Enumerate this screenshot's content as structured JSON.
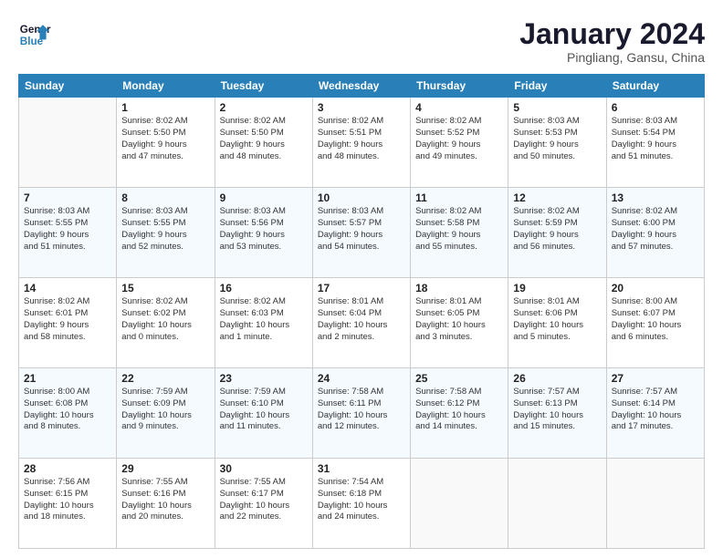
{
  "logo": {
    "line1": "General",
    "line2": "Blue"
  },
  "title": "January 2024",
  "subtitle": "Pingliang, Gansu, China",
  "days_header": [
    "Sunday",
    "Monday",
    "Tuesday",
    "Wednesday",
    "Thursday",
    "Friday",
    "Saturday"
  ],
  "weeks": [
    [
      {
        "day": "",
        "info": ""
      },
      {
        "day": "1",
        "info": "Sunrise: 8:02 AM\nSunset: 5:50 PM\nDaylight: 9 hours\nand 47 minutes."
      },
      {
        "day": "2",
        "info": "Sunrise: 8:02 AM\nSunset: 5:50 PM\nDaylight: 9 hours\nand 48 minutes."
      },
      {
        "day": "3",
        "info": "Sunrise: 8:02 AM\nSunset: 5:51 PM\nDaylight: 9 hours\nand 48 minutes."
      },
      {
        "day": "4",
        "info": "Sunrise: 8:02 AM\nSunset: 5:52 PM\nDaylight: 9 hours\nand 49 minutes."
      },
      {
        "day": "5",
        "info": "Sunrise: 8:03 AM\nSunset: 5:53 PM\nDaylight: 9 hours\nand 50 minutes."
      },
      {
        "day": "6",
        "info": "Sunrise: 8:03 AM\nSunset: 5:54 PM\nDaylight: 9 hours\nand 51 minutes."
      }
    ],
    [
      {
        "day": "7",
        "info": "Sunrise: 8:03 AM\nSunset: 5:55 PM\nDaylight: 9 hours\nand 51 minutes."
      },
      {
        "day": "8",
        "info": "Sunrise: 8:03 AM\nSunset: 5:55 PM\nDaylight: 9 hours\nand 52 minutes."
      },
      {
        "day": "9",
        "info": "Sunrise: 8:03 AM\nSunset: 5:56 PM\nDaylight: 9 hours\nand 53 minutes."
      },
      {
        "day": "10",
        "info": "Sunrise: 8:03 AM\nSunset: 5:57 PM\nDaylight: 9 hours\nand 54 minutes."
      },
      {
        "day": "11",
        "info": "Sunrise: 8:02 AM\nSunset: 5:58 PM\nDaylight: 9 hours\nand 55 minutes."
      },
      {
        "day": "12",
        "info": "Sunrise: 8:02 AM\nSunset: 5:59 PM\nDaylight: 9 hours\nand 56 minutes."
      },
      {
        "day": "13",
        "info": "Sunrise: 8:02 AM\nSunset: 6:00 PM\nDaylight: 9 hours\nand 57 minutes."
      }
    ],
    [
      {
        "day": "14",
        "info": "Sunrise: 8:02 AM\nSunset: 6:01 PM\nDaylight: 9 hours\nand 58 minutes."
      },
      {
        "day": "15",
        "info": "Sunrise: 8:02 AM\nSunset: 6:02 PM\nDaylight: 10 hours\nand 0 minutes."
      },
      {
        "day": "16",
        "info": "Sunrise: 8:02 AM\nSunset: 6:03 PM\nDaylight: 10 hours\nand 1 minute."
      },
      {
        "day": "17",
        "info": "Sunrise: 8:01 AM\nSunset: 6:04 PM\nDaylight: 10 hours\nand 2 minutes."
      },
      {
        "day": "18",
        "info": "Sunrise: 8:01 AM\nSunset: 6:05 PM\nDaylight: 10 hours\nand 3 minutes."
      },
      {
        "day": "19",
        "info": "Sunrise: 8:01 AM\nSunset: 6:06 PM\nDaylight: 10 hours\nand 5 minutes."
      },
      {
        "day": "20",
        "info": "Sunrise: 8:00 AM\nSunset: 6:07 PM\nDaylight: 10 hours\nand 6 minutes."
      }
    ],
    [
      {
        "day": "21",
        "info": "Sunrise: 8:00 AM\nSunset: 6:08 PM\nDaylight: 10 hours\nand 8 minutes."
      },
      {
        "day": "22",
        "info": "Sunrise: 7:59 AM\nSunset: 6:09 PM\nDaylight: 10 hours\nand 9 minutes."
      },
      {
        "day": "23",
        "info": "Sunrise: 7:59 AM\nSunset: 6:10 PM\nDaylight: 10 hours\nand 11 minutes."
      },
      {
        "day": "24",
        "info": "Sunrise: 7:58 AM\nSunset: 6:11 PM\nDaylight: 10 hours\nand 12 minutes."
      },
      {
        "day": "25",
        "info": "Sunrise: 7:58 AM\nSunset: 6:12 PM\nDaylight: 10 hours\nand 14 minutes."
      },
      {
        "day": "26",
        "info": "Sunrise: 7:57 AM\nSunset: 6:13 PM\nDaylight: 10 hours\nand 15 minutes."
      },
      {
        "day": "27",
        "info": "Sunrise: 7:57 AM\nSunset: 6:14 PM\nDaylight: 10 hours\nand 17 minutes."
      }
    ],
    [
      {
        "day": "28",
        "info": "Sunrise: 7:56 AM\nSunset: 6:15 PM\nDaylight: 10 hours\nand 18 minutes."
      },
      {
        "day": "29",
        "info": "Sunrise: 7:55 AM\nSunset: 6:16 PM\nDaylight: 10 hours\nand 20 minutes."
      },
      {
        "day": "30",
        "info": "Sunrise: 7:55 AM\nSunset: 6:17 PM\nDaylight: 10 hours\nand 22 minutes."
      },
      {
        "day": "31",
        "info": "Sunrise: 7:54 AM\nSunset: 6:18 PM\nDaylight: 10 hours\nand 24 minutes."
      },
      {
        "day": "",
        "info": ""
      },
      {
        "day": "",
        "info": ""
      },
      {
        "day": "",
        "info": ""
      }
    ]
  ],
  "colors": {
    "header_bg": "#2980b9",
    "header_text": "#ffffff",
    "alt_row_bg": "#f5faff"
  }
}
